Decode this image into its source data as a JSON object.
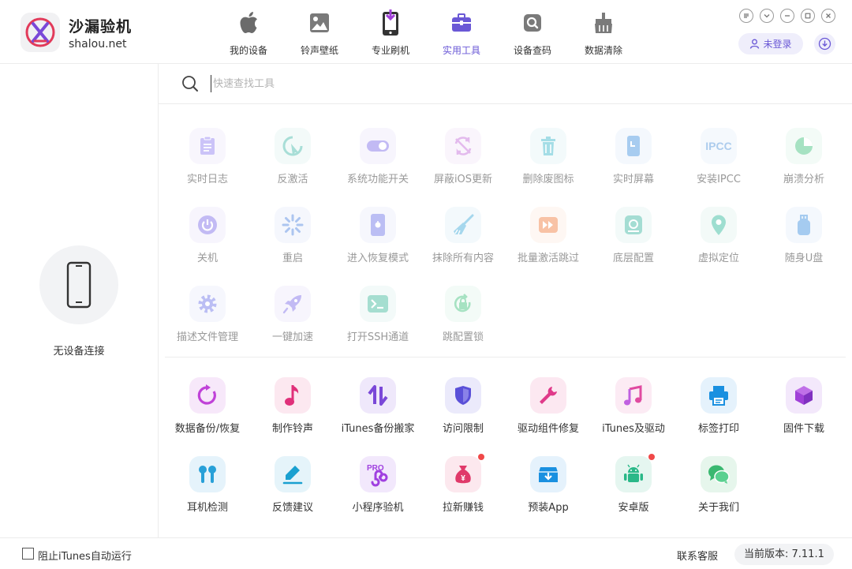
{
  "app": {
    "name": "沙漏验机",
    "domain": "shalou.net"
  },
  "nav": [
    {
      "label": "我的设备",
      "icon": "apple-icon",
      "active": false
    },
    {
      "label": "铃声壁纸",
      "icon": "wallpaper-icon",
      "active": false
    },
    {
      "label": "专业刷机",
      "icon": "flash-phone-icon",
      "active": false
    },
    {
      "label": "实用工具",
      "icon": "toolbox-icon",
      "active": true
    },
    {
      "label": "设备查码",
      "icon": "search-code-icon",
      "active": false
    },
    {
      "label": "数据清除",
      "icon": "clear-data-icon",
      "active": false
    }
  ],
  "account": {
    "login_label": "未登录"
  },
  "search": {
    "placeholder": "快速查找工具"
  },
  "sidebar": {
    "status": "无设备连接"
  },
  "tools_device": [
    {
      "label": "实时日志",
      "icon": "clipboard-log-icon",
      "color": "#8e7cf0"
    },
    {
      "label": "反激活",
      "icon": "pointer-icon",
      "color": "#3fb8a8"
    },
    {
      "label": "系统功能开关",
      "icon": "toggle-icon",
      "color": "#7a68e8"
    },
    {
      "label": "屏蔽iOS更新",
      "icon": "block-update-icon",
      "color": "#c268d8"
    },
    {
      "label": "删除废图标",
      "icon": "trash-icon",
      "color": "#37b6c8"
    },
    {
      "label": "实时屏幕",
      "icon": "phone-screen-icon",
      "color": "#3d8fe0"
    },
    {
      "label": "安装IPCC",
      "icon": "ipcc-icon",
      "color": "#4a90d8"
    },
    {
      "label": "崩溃分析",
      "icon": "pie-chart-icon",
      "color": "#3cc07a"
    },
    {
      "label": "关机",
      "icon": "power-icon",
      "color": "#7a68e8"
    },
    {
      "label": "重启",
      "icon": "restart-icon",
      "color": "#4a80e0"
    },
    {
      "label": "进入恢复模式",
      "icon": "recovery-icon",
      "color": "#6a70e8"
    },
    {
      "label": "抹除所有内容",
      "icon": "broom-icon",
      "color": "#3aa8d8"
    },
    {
      "label": "批量激活跳过",
      "icon": "fast-forward-icon",
      "color": "#f07a3a"
    },
    {
      "label": "底层配置",
      "icon": "config-icon",
      "color": "#37b6a0"
    },
    {
      "label": "虚拟定位",
      "icon": "location-icon",
      "color": "#2ab898"
    },
    {
      "label": "随身U盘",
      "icon": "usb-icon",
      "color": "#3a8ee0"
    },
    {
      "label": "描述文件管理",
      "icon": "gear-icon",
      "color": "#6a70e8"
    },
    {
      "label": "一键加速",
      "icon": "rocket-icon",
      "color": "#7a68e8"
    },
    {
      "label": "打开SSH通道",
      "icon": "terminal-icon",
      "color": "#3ab898"
    },
    {
      "label": "跳配置锁",
      "icon": "unlock-icon",
      "color": "#3cc07a"
    }
  ],
  "tools_general": [
    {
      "label": "数据备份/恢复",
      "icon": "backup-icon",
      "color": "#c042d8",
      "badge": false
    },
    {
      "label": "制作铃声",
      "icon": "music-note-icon",
      "color": "#e0307a",
      "badge": false
    },
    {
      "label": "iTunes备份搬家",
      "icon": "transfer-icon",
      "color": "#7a48d8",
      "badge": false
    },
    {
      "label": "访问限制",
      "icon": "shield-icon",
      "color": "#5a50d8",
      "badge": false
    },
    {
      "label": "驱动组件修复",
      "icon": "wrench-icon",
      "color": "#e03a8a",
      "badge": false
    },
    {
      "label": "iTunes及驱动",
      "icon": "itunes-icon",
      "color": "#e04aa0",
      "badge": false
    },
    {
      "label": "标签打印",
      "icon": "printer-icon",
      "color": "#1a90e0",
      "badge": false
    },
    {
      "label": "固件下载",
      "icon": "cube-icon",
      "color": "#a040d8",
      "badge": false
    },
    {
      "label": "耳机检测",
      "icon": "earbuds-icon",
      "color": "#28a0d8",
      "badge": false
    },
    {
      "label": "反馈建议",
      "icon": "edit-icon",
      "color": "#1aa0d0",
      "badge": false
    },
    {
      "label": "小程序验机",
      "icon": "mini-program-icon",
      "color": "#a040e0",
      "badge": false
    },
    {
      "label": "拉新赚钱",
      "icon": "money-bag-icon",
      "color": "#e03a6a",
      "badge": true
    },
    {
      "label": "预装App",
      "icon": "app-download-icon",
      "color": "#1a90e0",
      "badge": false
    },
    {
      "label": "安卓版",
      "icon": "android-icon",
      "color": "#2ab888",
      "badge": true
    },
    {
      "label": "关于我们",
      "icon": "chat-icon",
      "color": "#3ab870",
      "badge": false
    }
  ],
  "footer": {
    "itunes_block_label": "阻止iTunes自动运行",
    "contact_label": "联系客服",
    "version_label": "当前版本: 7.11.1"
  }
}
